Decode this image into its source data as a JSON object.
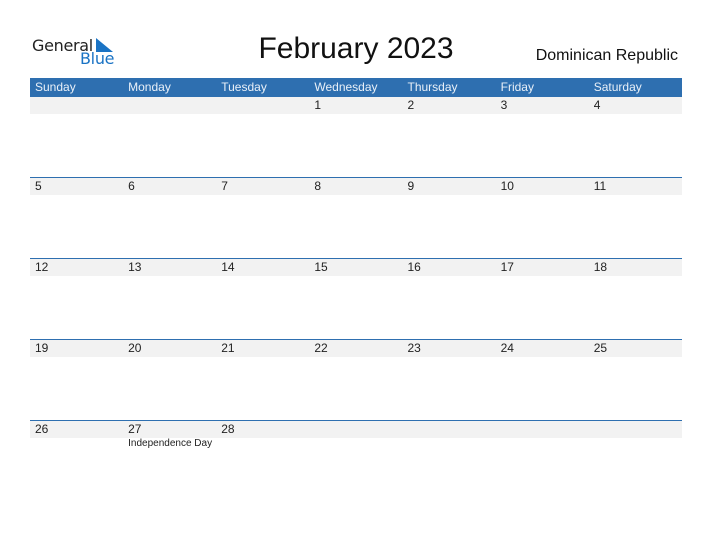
{
  "logo": {
    "part1": "General",
    "part2": "Blue"
  },
  "title": "February 2023",
  "country": "Dominican Republic",
  "colors": {
    "accent": "#2e6fb0",
    "row_bg": "#f2f2f2",
    "logo_blue": "#1a73c4"
  },
  "weekdays": [
    "Sunday",
    "Monday",
    "Tuesday",
    "Wednesday",
    "Thursday",
    "Friday",
    "Saturday"
  ],
  "weeks": [
    {
      "days": [
        "",
        "",
        "",
        "1",
        "2",
        "3",
        "4"
      ],
      "events": [
        "",
        "",
        "",
        "",
        "",
        "",
        ""
      ]
    },
    {
      "days": [
        "5",
        "6",
        "7",
        "8",
        "9",
        "10",
        "11"
      ],
      "events": [
        "",
        "",
        "",
        "",
        "",
        "",
        ""
      ]
    },
    {
      "days": [
        "12",
        "13",
        "14",
        "15",
        "16",
        "17",
        "18"
      ],
      "events": [
        "",
        "",
        "",
        "",
        "",
        "",
        ""
      ]
    },
    {
      "days": [
        "19",
        "20",
        "21",
        "22",
        "23",
        "24",
        "25"
      ],
      "events": [
        "",
        "",
        "",
        "",
        "",
        "",
        ""
      ]
    },
    {
      "days": [
        "26",
        "27",
        "28",
        "",
        "",
        "",
        ""
      ],
      "events": [
        "",
        "Independence Day",
        "",
        "",
        "",
        "",
        ""
      ]
    }
  ]
}
